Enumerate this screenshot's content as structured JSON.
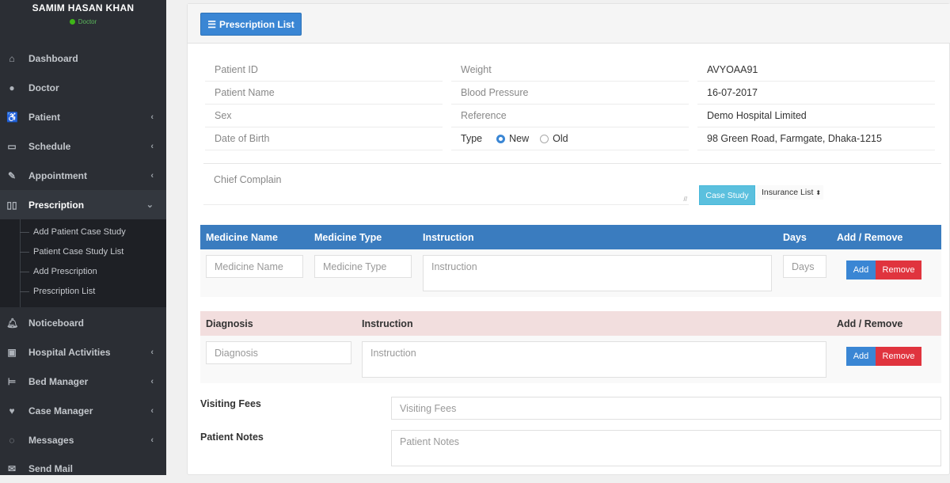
{
  "sidebar": {
    "user_name": "SAMIM HASAN KHAN",
    "user_role": "Doctor",
    "status_color": "#3fb618",
    "items": [
      {
        "label": "Dashboard",
        "icon": "home-icon",
        "has_chevron": false
      },
      {
        "label": "Doctor",
        "icon": "user-md-icon",
        "has_chevron": false
      },
      {
        "label": "Patient",
        "icon": "wheelchair-icon",
        "has_chevron": true
      },
      {
        "label": "Schedule",
        "icon": "calendar-icon",
        "has_chevron": true
      },
      {
        "label": "Appointment",
        "icon": "edit-icon",
        "has_chevron": true
      },
      {
        "label": "Prescription",
        "icon": "book-icon",
        "has_chevron": true,
        "active": true
      },
      {
        "label": "Noticeboard",
        "icon": "bell-icon",
        "has_chevron": false
      },
      {
        "label": "Hospital Activities",
        "icon": "hospital-icon",
        "has_chevron": true
      },
      {
        "label": "Bed Manager",
        "icon": "bed-icon",
        "has_chevron": true
      },
      {
        "label": "Case Manager",
        "icon": "heartbeat-icon",
        "has_chevron": true
      },
      {
        "label": "Messages",
        "icon": "comments-icon",
        "has_chevron": true
      },
      {
        "label": "Send Mail",
        "icon": "envelope-icon",
        "has_chevron": false
      }
    ],
    "submenu": [
      "Add Patient Case Study",
      "Patient Case Study List",
      "Add Prescription",
      "Prescription List"
    ]
  },
  "header": {
    "prescription_list_button": "Prescription List"
  },
  "patient_info": {
    "col1": [
      "Patient ID",
      "Patient  Name",
      "Sex",
      "Date of Birth"
    ],
    "col2": [
      "Weight",
      "Blood Pressure",
      "Reference"
    ],
    "type_label": "Type",
    "type_options": [
      "New",
      "Old"
    ],
    "type_selected": "New",
    "col3": [
      "AVYOAA91",
      "16-07-2017",
      "Demo Hospital Limited",
      "98 Green Road, Farmgate, Dhaka-1215"
    ]
  },
  "chief_complain": {
    "placeholder": "Chief Complain"
  },
  "case_study_button": "Case Study",
  "insurance_select": {
    "selected": "Insurance List"
  },
  "medicine_table": {
    "headers": [
      "Medicine Name",
      "Medicine Type",
      "Instruction",
      "Days",
      "Add / Remove"
    ],
    "placeholders": {
      "name": "Medicine Name",
      "type": "Medicine Type",
      "instruction": "Instruction",
      "days": "Days"
    },
    "add_label": "Add",
    "remove_label": "Remove"
  },
  "diagnosis_table": {
    "headers": [
      "Diagnosis",
      "Instruction",
      "Add / Remove"
    ],
    "placeholders": {
      "diagnosis": "Diagnosis",
      "instruction": "Instruction"
    },
    "add_label": "Add",
    "remove_label": "Remove"
  },
  "visiting_fees": {
    "label": "Visiting Fees",
    "placeholder": "Visiting Fees"
  },
  "patient_notes": {
    "label": "Patient Notes",
    "placeholder": "Patient Notes"
  },
  "colors": {
    "primary": "#3a86d4",
    "danger": "#e0343e",
    "info": "#5bc0de",
    "table_header": "#3a7cbf",
    "diagnosis_header": "#f2dede",
    "sidebar_bg": "#2b2e34"
  }
}
